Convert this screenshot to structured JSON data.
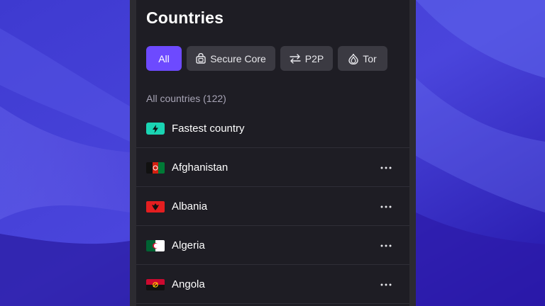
{
  "page": {
    "title": "Countries"
  },
  "filters": [
    {
      "label": "All",
      "icon": "",
      "active": true
    },
    {
      "label": "Secure Core",
      "icon": "secure-core-icon",
      "active": false
    },
    {
      "label": "P2P",
      "icon": "swap-arrows-icon",
      "active": false
    },
    {
      "label": "Tor",
      "icon": "onion-icon",
      "active": false
    }
  ],
  "section": {
    "label": "All countries (122)"
  },
  "fastest": {
    "label": "Fastest country",
    "icon": "bolt-icon"
  },
  "countries": [
    {
      "name": "Afghanistan"
    },
    {
      "name": "Albania"
    },
    {
      "name": "Algeria"
    },
    {
      "name": "Angola"
    }
  ],
  "colors": {
    "accent": "#6d4aff",
    "fastest": "#1ad4b3",
    "panel_bg": "#1e1d24",
    "chip_bg": "#3b3a42",
    "muted_text": "#a7a4b5"
  }
}
